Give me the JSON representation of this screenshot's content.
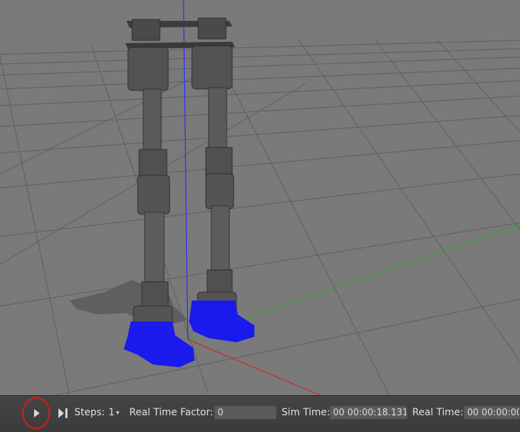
{
  "toolbar": {
    "play_icon": "play-icon",
    "step_icon": "step-forward-icon",
    "steps_label": "Steps:",
    "steps_value": "1",
    "rtf_label": "Real Time Factor:",
    "rtf_value": "0",
    "sim_time_label": "Sim Time:",
    "sim_time_value": "00 00:00:18.131",
    "real_time_label": "Real Time:",
    "real_time_value": "00 00:00:00"
  },
  "colors": {
    "ground": "#7a7a7a",
    "grid": "#5c5c5c",
    "foot": "#1a1aee",
    "z_axis": "#2a2aff",
    "y_axis": "#20b020",
    "x_axis": "#d02020",
    "annotation": "#e01818"
  }
}
